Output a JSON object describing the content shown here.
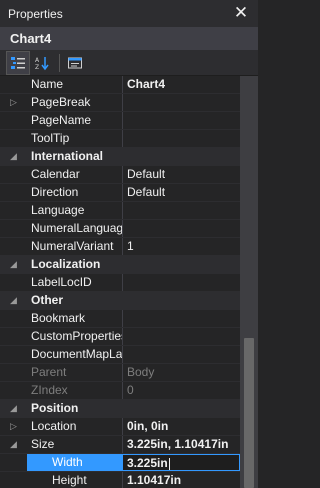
{
  "window": {
    "title": "Properties",
    "close_glyph": "✕"
  },
  "object_name": "Chart4",
  "toolbar": {
    "buttons": [
      "categorized-icon",
      "alphabetical-icon",
      "property-pages-icon"
    ]
  },
  "rows": [
    {
      "name": "Name",
      "value": "Chart4",
      "type": "bold"
    },
    {
      "name": "PageBreak",
      "value": "",
      "type": "expandable"
    },
    {
      "name": "PageName",
      "value": "",
      "type": "prop"
    },
    {
      "name": "ToolTip",
      "value": "",
      "type": "prop"
    },
    {
      "name": "International",
      "value": "",
      "type": "category"
    },
    {
      "name": "Calendar",
      "value": "Default",
      "type": "prop"
    },
    {
      "name": "Direction",
      "value": "Default",
      "type": "prop"
    },
    {
      "name": "Language",
      "value": "",
      "type": "prop"
    },
    {
      "name": "NumeralLanguag",
      "value": "",
      "type": "prop"
    },
    {
      "name": "NumeralVariant",
      "value": "1",
      "type": "prop"
    },
    {
      "name": "Localization",
      "value": "",
      "type": "category"
    },
    {
      "name": "LabelLocID",
      "value": "",
      "type": "prop"
    },
    {
      "name": "Other",
      "value": "",
      "type": "category"
    },
    {
      "name": "Bookmark",
      "value": "",
      "type": "prop"
    },
    {
      "name": "CustomProperties",
      "value": "",
      "type": "prop"
    },
    {
      "name": "DocumentMapLal",
      "value": "",
      "type": "prop"
    },
    {
      "name": "Parent",
      "value": "Body",
      "type": "disabled"
    },
    {
      "name": "ZIndex",
      "value": "0",
      "type": "disabled"
    },
    {
      "name": "Position",
      "value": "",
      "type": "category"
    },
    {
      "name": "Location",
      "value": "0in, 0in",
      "type": "expandable-bold"
    },
    {
      "name": "Size",
      "value": "3.225in, 1.10417in",
      "type": "expanded-bold"
    },
    {
      "name": "Width",
      "value": "3.225in",
      "type": "sub-selected"
    },
    {
      "name": "Height",
      "value": "1.10417in",
      "type": "sub"
    }
  ]
}
